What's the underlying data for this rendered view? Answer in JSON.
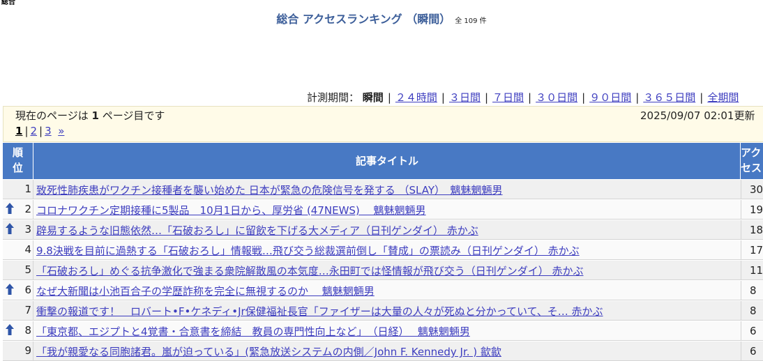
{
  "corner_label": "総合",
  "header": {
    "title": "総合 アクセスランキング （瞬間）",
    "count": "全 109 件"
  },
  "period": {
    "label": "計測期間：",
    "current": "瞬間",
    "links": [
      "２４時間",
      "３日間",
      "７日間",
      "３０日間",
      "９０日間",
      "３６５日間",
      "全期間"
    ]
  },
  "info": {
    "page_text_prefix": "現在のページは ",
    "page_number": "1",
    "page_text_suffix": " ページ目です",
    "updated": "2025/09/07 02:01更新"
  },
  "pager": {
    "current": "1",
    "pages": [
      "2",
      "3"
    ],
    "next": "»"
  },
  "table": {
    "col_rank": [
      "順",
      "位"
    ],
    "col_title": "記事タイトル",
    "col_access": [
      "アク",
      "セス"
    ],
    "rows": [
      {
        "rank": "1",
        "up": false,
        "title": "致死性肺疾患がワクチン接種者を襲い始めた 日本が緊急の危険信号を発する （SLAY）　魑魅魍魎男",
        "access": "30"
      },
      {
        "rank": "2",
        "up": true,
        "title": "コロナワクチン定期接種に5製品　10月1日から、厚労省 (47NEWS)　 魑魅魍魎男",
        "access": "19"
      },
      {
        "rank": "3",
        "up": true,
        "title": "辟易するような旧態依然…「石破おろし」に留飲を下げる大メディア（日刊ゲンダイ）  赤かぶ",
        "access": "18"
      },
      {
        "rank": "4",
        "up": false,
        "title": "9.8決戦を目前に過熱する「石破おろし」情報戦…飛び交う総裁選前倒し「賛成」の票読み（日刊ゲンダイ）  赤かぶ",
        "access": "17"
      },
      {
        "rank": "5",
        "up": false,
        "title": "「石破おろし」めぐる抗争激化で強まる衆院解散風の本気度…永田町では怪情報が飛び交う（日刊ゲンダイ）  赤かぶ",
        "access": "11"
      },
      {
        "rank": "6",
        "up": true,
        "title": "なぜ大新聞は小池百合子の学歴詐称を完全に無視するのか　 魑魅魍魎男",
        "access": "8"
      },
      {
        "rank": "7",
        "up": false,
        "title": "衝撃の報道です！　ロバート•F•ケネディ•Jr保健福祉長官「ファイザーは大量の人々が死ぬと分かっていて、そ…  赤かぶ",
        "access": "8"
      },
      {
        "rank": "8",
        "up": true,
        "title": "「東京都、エジプトと4覚書・合意書を締結　教員の専門性向上など」　（日経）　 魑魅魍魎男",
        "access": "6"
      },
      {
        "rank": "9",
        "up": false,
        "title": "「我が親愛なる同胞諸君。嵐が迫っている」(緊急放送システムの内側／John F. Kennedy Jr. ) 歙歙",
        "access": "6"
      }
    ]
  },
  "colors": {
    "accent": "#4879c4",
    "title": "#3d5f9a",
    "link": "#3d3dbf",
    "info_bg": "#fffbe8"
  }
}
